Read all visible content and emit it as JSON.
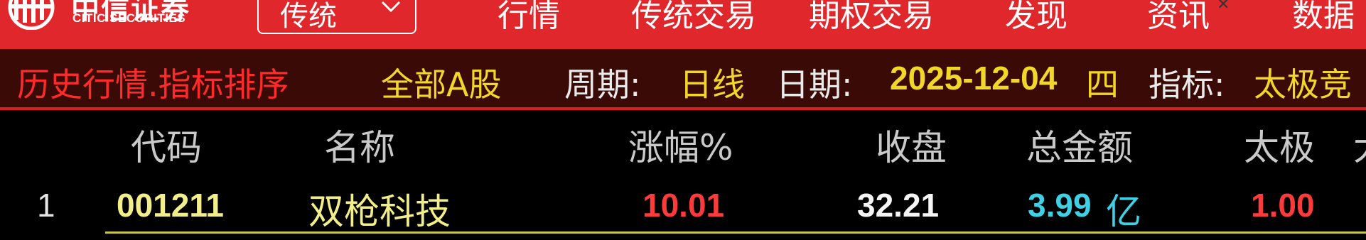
{
  "topbar": {
    "logo_cn": "中信证券",
    "logo_en": "CITIC SECURITIES",
    "mode_label": "传统",
    "nav": [
      "行情",
      "传统交易",
      "期权交易",
      "发现",
      "资讯",
      "数据"
    ],
    "close_glyph": "✕"
  },
  "header": {
    "title": "历史行情.指标排序",
    "scope": "全部A股",
    "period_label": "周期:",
    "period_value": "日线",
    "date_label": "日期:",
    "date_value": "2025-12-04",
    "weekday": "四",
    "indicator_label": "指标:",
    "indicator_value": "太极竞"
  },
  "table": {
    "columns": [
      "代码",
      "名称",
      "涨幅%",
      "收盘",
      "总金额",
      "太极",
      "大"
    ],
    "rows": [
      {
        "index": "1",
        "code": "001211",
        "name": "双枪科技",
        "change_pct": "10.01",
        "close": "32.21",
        "amount": "3.99",
        "amount_unit": "亿",
        "taiji": "1.00"
      }
    ]
  },
  "colors": {
    "topbar_bg": "#e0272c",
    "header_bg": "#3a0a07",
    "up_red": "#ff3a3a",
    "code_yellow": "#f2ef8a",
    "amount_cyan": "#3fd0e6",
    "header_yellow": "#f2d628"
  }
}
